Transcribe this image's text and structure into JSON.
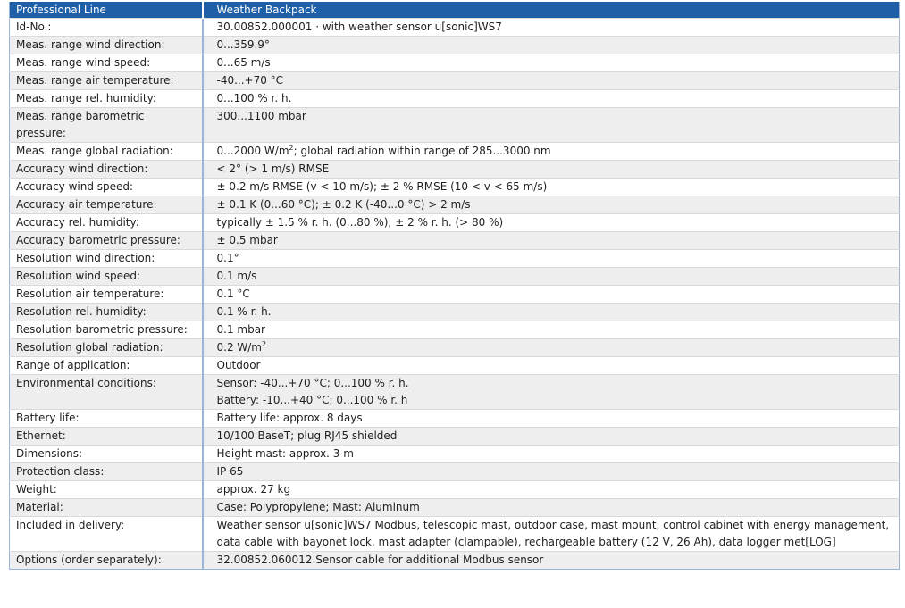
{
  "header": {
    "left": "Professional Line",
    "right": "Weather Backpack"
  },
  "rows": [
    {
      "label": "Id-No.:",
      "value": "30.00852.000001 · with weather sensor u[sonic]WS7"
    },
    {
      "label": "Meas. range wind direction:",
      "value": "0...359.9°"
    },
    {
      "label": "Meas. range wind speed:",
      "value": "0...65 m/s"
    },
    {
      "label": "Meas. range air temperature:",
      "value": "-40...+70 °C"
    },
    {
      "label": "Meas. range rel. humidity:",
      "value": "0...100 % r. h."
    },
    {
      "label": "Meas. range barometric pressure:",
      "value": "300...1100 mbar"
    },
    {
      "label": "Meas. range global radiation:",
      "value": "0...2000 W/m",
      "sup": "2",
      "suffix": "; global radiation within range of 285...3000 nm"
    },
    {
      "label": "Accuracy wind direction:",
      "value": "< 2° (> 1 m/s) RMSE"
    },
    {
      "label": "Accuracy wind speed:",
      "value": "± 0.2 m/s RMSE (v < 10 m/s); ± 2 % RMSE (10 < v < 65 m/s)"
    },
    {
      "label": "Accuracy air temperature:",
      "value": "± 0.1 K (0...60 °C); ± 0.2 K (-40...0 °C) > 2 m/s"
    },
    {
      "label": "Accuracy rel. humidity:",
      "value": "typically ± 1.5 % r. h. (0...80 %); ± 2 % r. h. (> 80 %)"
    },
    {
      "label": "Accuracy barometric pressure:",
      "value": "± 0.5 mbar"
    },
    {
      "label": "Resolution wind direction:",
      "value": "0.1°"
    },
    {
      "label": "Resolution wind speed:",
      "value": "0.1 m/s"
    },
    {
      "label": "Resolution air temperature:",
      "value": "0.1 °C"
    },
    {
      "label": "Resolution rel. humidity:",
      "value": "0.1 % r. h."
    },
    {
      "label": "Resolution barometric pressure:",
      "value": "0.1 mbar"
    },
    {
      "label": "Resolution global radiation:",
      "value": "0.2 W/m",
      "sup": "2",
      "suffix": ""
    },
    {
      "label": "Range of application:",
      "value": "Outdoor"
    },
    {
      "label": "Environmental conditions:",
      "value": "Sensor: -40...+70 °C; 0...100 % r. h.",
      "value2": "Battery: -10...+40 °C; 0...100 % r. h"
    },
    {
      "label": "Battery life:",
      "value": "Battery life: approx. 8 days"
    },
    {
      "label": "Ethernet:",
      "value": "10/100 BaseT; plug RJ45 shielded"
    },
    {
      "label": "Dimensions:",
      "value": "Height mast: approx. 3 m"
    },
    {
      "label": "Protection class:",
      "value": "IP 65"
    },
    {
      "label": "Weight:",
      "value": "approx. 27 kg"
    },
    {
      "label": "Material:",
      "value": "Case: Polypropylene; Mast: Aluminum"
    },
    {
      "label": "Included in delivery:",
      "value": "Weather sensor u[sonic]WS7 Modbus, telescopic mast, outdoor case, mast mount, control cabinet with energy management, data cable with bayonet lock, mast adapter (clampable), rechargeable battery (12 V, 26 Ah), data logger met[LOG]"
    },
    {
      "label": "Options (order separately):",
      "value": "32.00852.060012 Sensor cable for additional Modbus sensor"
    }
  ]
}
